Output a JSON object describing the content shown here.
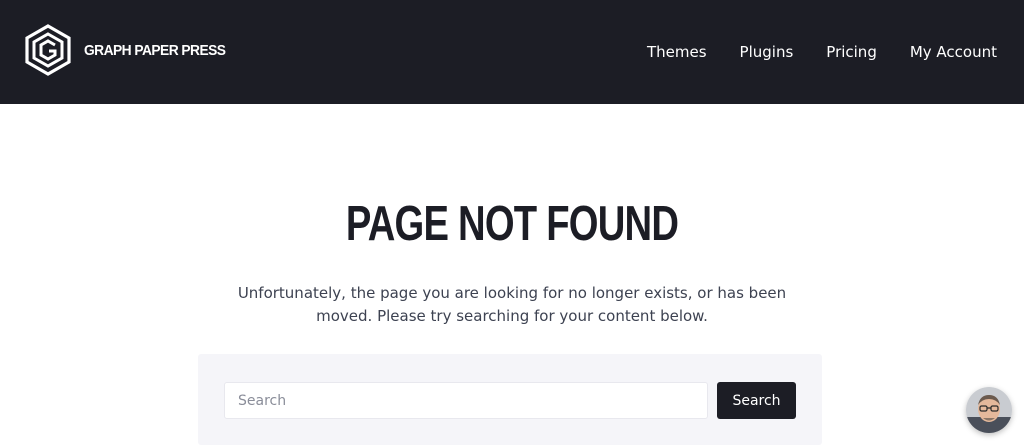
{
  "brand": {
    "name": "GRAPH PAPER PRESS",
    "logo_icon": "hexagon-g-logo-icon",
    "header_bg": "#1c1d25"
  },
  "nav": {
    "items": [
      {
        "label": "Themes"
      },
      {
        "label": "Plugins"
      },
      {
        "label": "Pricing"
      },
      {
        "label": "My Account"
      }
    ]
  },
  "main": {
    "title": "PAGE NOT FOUND",
    "message": "Unfortunately, the page you are looking for no longer exists, or has been moved. Please try searching for your content below."
  },
  "search": {
    "placeholder": "Search",
    "value": "",
    "button_label": "Search"
  },
  "chat": {
    "avatar_icon": "support-agent-avatar-icon"
  }
}
